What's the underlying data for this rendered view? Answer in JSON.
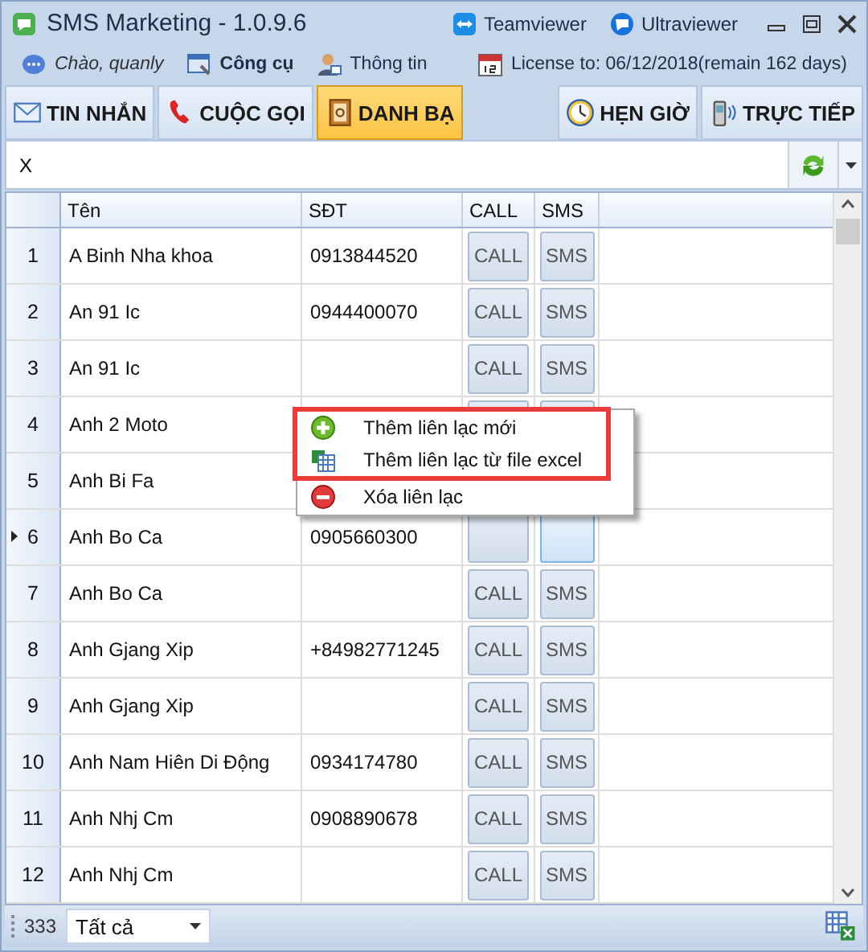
{
  "window": {
    "title": "SMS Marketing - 1.0.9.6",
    "links": [
      {
        "label": "Teamviewer",
        "kind": "teamviewer"
      },
      {
        "label": "Ultraviewer",
        "kind": "ultraviewer"
      }
    ]
  },
  "toolbar": {
    "greeting": "Chào, quanly",
    "items": [
      {
        "label": "Công cụ",
        "kind": "tools"
      },
      {
        "label": "Thông tin",
        "kind": "info"
      }
    ],
    "license": "License to: 06/12/2018(remain 162 days)"
  },
  "tabs": [
    {
      "label": "TIN NHẮN",
      "kind": "message",
      "selected": false
    },
    {
      "label": "CUỘC GỌI",
      "kind": "phone",
      "selected": false
    },
    {
      "label": "DANH BẠ",
      "kind": "contacts",
      "selected": true
    }
  ],
  "tabs_right": [
    {
      "label": "HẸN GIỜ",
      "kind": "clock",
      "selected": false
    },
    {
      "label": "TRỰC TIẾP",
      "kind": "live",
      "selected": false
    }
  ],
  "search": {
    "value": "X"
  },
  "table": {
    "columns": [
      "Tên",
      "SĐT",
      "CALL",
      "SMS"
    ],
    "rows": [
      {
        "index": "1",
        "name": "A Binh Nha khoa",
        "phone": "0913844520",
        "call": "CALL",
        "sms": "SMS",
        "selected": false
      },
      {
        "index": "2",
        "name": "An 91 Ic",
        "phone": "0944400070",
        "call": "CALL",
        "sms": "SMS",
        "selected": false
      },
      {
        "index": "3",
        "name": "An 91 Ic",
        "call": "CALL",
        "sms": "SMS",
        "selected": false
      },
      {
        "index": "4",
        "name": "Anh 2 Moto",
        "selected": false
      },
      {
        "index": "5",
        "name": "Anh Bi Fa",
        "covered": true,
        "selected": false
      },
      {
        "index": "6",
        "name": "Anh Bo Ca",
        "phone": "0905660300",
        "selected": true
      },
      {
        "index": "7",
        "name": "Anh Bo Ca",
        "call": "CALL",
        "sms": "SMS",
        "selected": false
      },
      {
        "index": "8",
        "name": "Anh Gjang Xip",
        "phone": "+84982771245",
        "call": "CALL",
        "sms": "SMS",
        "selected": false
      },
      {
        "index": "9",
        "name": "Anh Gjang Xip",
        "call": "CALL",
        "sms": "SMS",
        "selected": false
      },
      {
        "index": "10",
        "name": "Anh Nam Hiên Di Động",
        "phone": "0934174780",
        "call": "CALL",
        "sms": "SMS",
        "selected": false
      },
      {
        "index": "11",
        "name": "Anh Nhj Cm",
        "phone": "0908890678",
        "call": "CALL",
        "sms": "SMS",
        "selected": false
      },
      {
        "index": "12",
        "name": "Anh Nhj Cm",
        "call": "CALL",
        "sms": "SMS",
        "selected": false
      }
    ]
  },
  "context_menu": {
    "items": [
      {
        "label": "Thêm liên lạc mới",
        "kind": "add",
        "highlighted": true
      },
      {
        "label": "Thêm liên lạc từ file excel",
        "kind": "excel",
        "highlighted": true
      },
      {
        "label": "Xóa liên lạc",
        "kind": "delete",
        "highlighted": false
      }
    ]
  },
  "status_bar": {
    "count": "333",
    "filter": "Tất cả"
  }
}
